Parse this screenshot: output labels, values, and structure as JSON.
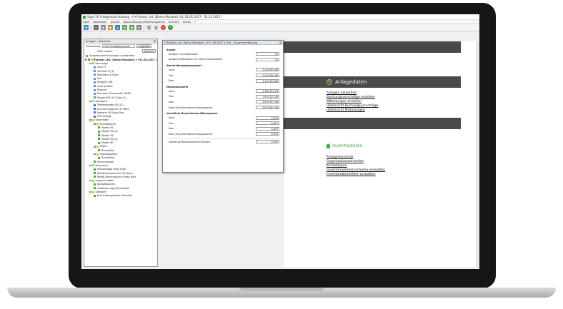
{
  "window": {
    "title": "Sage 50 Anlagenbuchhaltung - [I+Fantasy Ltd. (Demo Mandant) GJ: 01.01.2017 - 31.12.2017]"
  },
  "menu": [
    "Datei",
    "Bearbeiten",
    "Ansicht",
    "Abschreibungen/Mitteilungsdruck",
    "Berichte",
    "Extras",
    "?"
  ],
  "tree_panel": {
    "title": "Anlagen - Übersicht",
    "display_label": "Darstellung:",
    "display_value": "nach Anlagengruppe",
    "filter_label": "Filter inaktiv",
    "legend_button": "Legende",
    "search_button": "Suchen",
    "hide_retired_label": "Ausgemusterte Anlagen ausblenden",
    "items": [
      {
        "label": "I+Fantasy Ltd. (Demo Mandant), I+31.06.2017 1",
        "level": 0,
        "icon": "company",
        "bold": true
      },
      {
        "label": "Fahrzeuge",
        "level": 1,
        "icon": "folder"
      },
      {
        "label": "Audi TT",
        "level": 2,
        "icon": "car"
      },
      {
        "label": "VW Golf IV [1]",
        "level": 2,
        "icon": "car"
      },
      {
        "label": "Mercedes A-Class",
        "level": 2,
        "icon": "car"
      },
      {
        "label": "Fiat",
        "level": 2,
        "icon": "car"
      },
      {
        "label": "Peugeot 106",
        "level": 2,
        "icon": "car"
      },
      {
        "label": "Audi Quattro",
        "level": 2,
        "icon": "car"
      },
      {
        "label": "Porsche",
        "level": 2,
        "icon": "car"
      },
      {
        "label": "Mercedes Transporter VR68",
        "level": 2,
        "icon": "car"
      },
      {
        "label": "Mazda 626 GX Turbo [1]",
        "level": 2,
        "icon": "car"
      },
      {
        "label": "Hardware",
        "level": 1,
        "icon": "folder"
      },
      {
        "label": "Telefonanlage X15 [1]",
        "level": 2,
        "icon": "pc"
      },
      {
        "label": "Drucker Faxbtron HP 5809",
        "level": 2,
        "icon": "pc"
      },
      {
        "label": "Kopierer HP Copy-Star",
        "level": 2,
        "icon": "pc"
      },
      {
        "label": "EDV-Anlage",
        "level": 2,
        "icon": "pc"
      },
      {
        "label": "Büromöbel",
        "level": 1,
        "icon": "folder"
      },
      {
        "label": "Schreibtische",
        "level": 2,
        "icon": "folder"
      },
      {
        "label": "Modell 95",
        "level": 3,
        "icon": "leaf"
      },
      {
        "label": "Modell 95 [1]",
        "level": 3,
        "icon": "leaf"
      },
      {
        "label": "Modell 95",
        "level": 3,
        "icon": "leaf"
      },
      {
        "label": "Modell 95 [1]",
        "level": 3,
        "icon": "leaf"
      },
      {
        "label": "Modell 60",
        "level": 3,
        "icon": "leaf"
      },
      {
        "label": "Stühle",
        "level": 2,
        "icon": "folder"
      },
      {
        "label": "Bürostühle",
        "level": 3,
        "icon": "leaf"
      },
      {
        "label": "Sitzungsstühle",
        "level": 2,
        "icon": "folder"
      },
      {
        "label": "Bürostühle",
        "level": 3,
        "icon": "leaf"
      },
      {
        "label": "Bücherregale",
        "level": 2,
        "icon": "leaf"
      },
      {
        "label": "Maschinen",
        "level": 1,
        "icon": "folder"
      },
      {
        "label": "Klimaanlage Frost 2000",
        "level": 2,
        "icon": "leaf"
      },
      {
        "label": "Metallfräsmaschine GH Quick",
        "level": 2,
        "icon": "leaf"
      },
      {
        "label": "Metall-Bohrmaschine Deep Hole",
        "level": 2,
        "icon": "leaf"
      },
      {
        "label": "Liegenschaften",
        "level": 1,
        "icon": "folder"
      },
      {
        "label": "Bürogebäude 1",
        "level": 2,
        "icon": "leaf"
      },
      {
        "label": "Gebäude Lager/Produktion",
        "level": 2,
        "icon": "leaf"
      },
      {
        "label": "Software",
        "level": 1,
        "icon": "folder"
      },
      {
        "label": "Buchhaltungspaket Standard",
        "level": 2,
        "icon": "leaf"
      }
    ]
  },
  "popup": {
    "title": "I+Fantasy Ltd. (Demo Mandant), I+31.06.2017 13:04 - Zusammenfassung",
    "sections": [
      {
        "header": "Anzahl",
        "rows": [
          {
            "label": "Anlagen und Subanlagen",
            "value": "31"
          },
          {
            "label": "Anlagen/Subanlagen mit Abschreibungsdaten",
            "value": "31"
          }
        ]
      },
      {
        "header": "Abschreibungsbezugswert",
        "rows": [
          {
            "label": "Anbu",
            "value": "2'124'455.08"
          },
          {
            "label": "Fibu",
            "value": "2'124'455.08"
          },
          {
            "label": "Kore",
            "value": "2'124'455.08"
          }
        ]
      },
      {
        "header": "Momentanwerte",
        "rows": [
          {
            "label": "Anbu",
            "value": "2'164'410.18"
          },
          {
            "label": "Fibu",
            "value": "1'932'127.49"
          },
          {
            "label": "Kore",
            "value": "2'035'547.46"
          },
          {
            "label": "Kore (ohne Überabschreibungswerte)",
            "value": "2'035'547.46"
          }
        ]
      },
      {
        "header": "Verhältnis Momentanwert/Bezugswert",
        "rows": [
          {
            "label": "Anbu",
            "value": "0.833"
          },
          {
            "label": "Fibu",
            "value": "0.817"
          },
          {
            "label": "Kore",
            "value": "0.833"
          },
          {
            "label": "Kore (ohne Überabschreibungswerte)",
            "value": "0.833"
          }
        ]
      },
      {
        "header": "",
        "rows": [
          {
            "label": "Verhältnis Momentanwert Fibu/Kore",
            "value": "0.947"
          }
        ]
      }
    ]
  },
  "right": {
    "anlagedaten_title": "Anlagedaten",
    "anlagedaten_links": [
      "Anlagen verwalten",
      "Buchungsvorschläge erstellen",
      "Mitteilungen erstellen",
      "Uebersicht Buchungsvorschläge",
      "Uebersicht Mitteilungen"
    ],
    "inventar_title": "Inventardaten",
    "inventar_links": [
      "Anlagestandorte",
      "Organisationseinheiten",
      "Kontaktypen",
      "Inventarnummernschema verwalten",
      "Inventardatenfelder verwalten"
    ]
  }
}
